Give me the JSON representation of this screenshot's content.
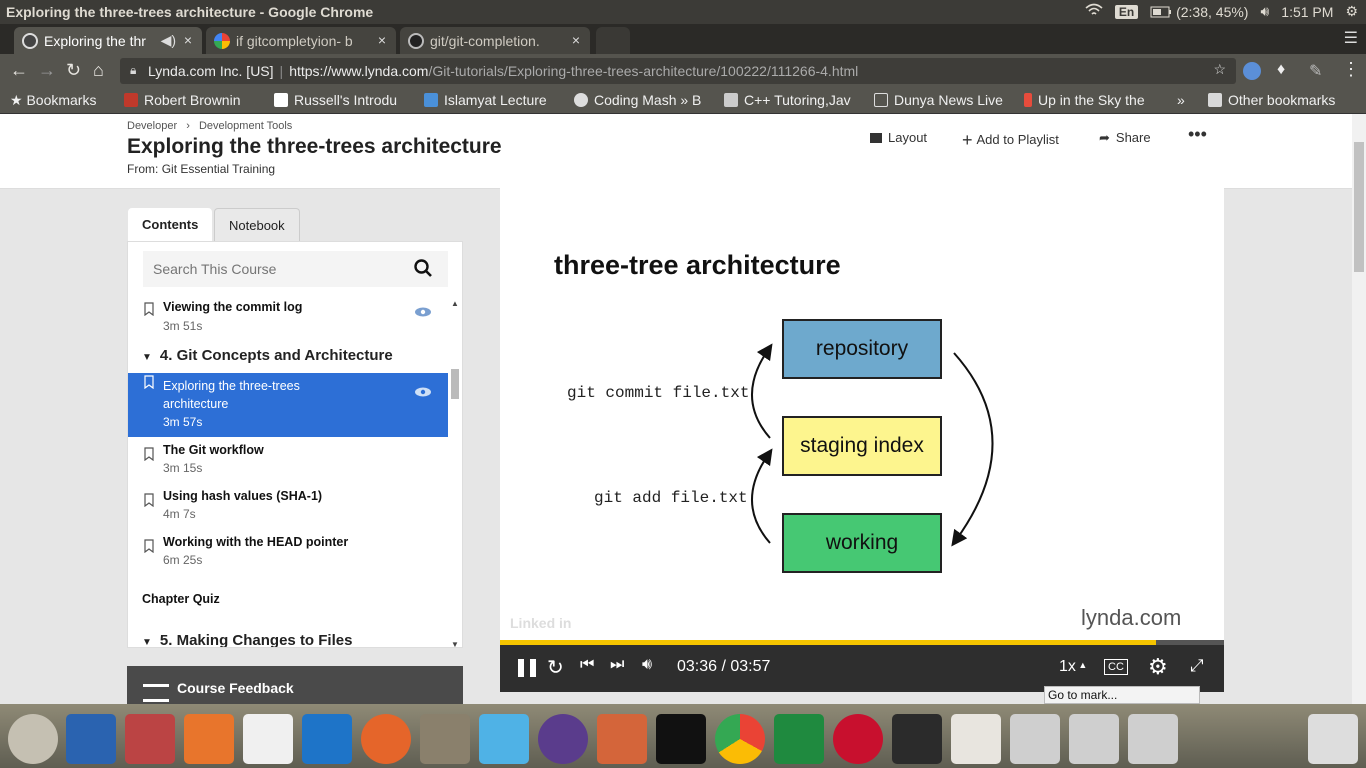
{
  "os": {
    "window_title": "Exploring the three-trees architecture - Google Chrome",
    "keyboard": "En",
    "battery": "(2:38, 45%)",
    "clock": "1:51 PM"
  },
  "tabs": [
    {
      "label": "Exploring the thr",
      "active": true
    },
    {
      "label": "if gitcompletyion- b",
      "active": false
    },
    {
      "label": "git/git-completion.",
      "active": false
    }
  ],
  "omnibox": {
    "secure_label": "Lynda.com Inc. [US]",
    "url_host": "https://www.lynda.com",
    "url_path": "/Git-tutorials/Exploring-three-trees-architecture/100222/111266-4.html"
  },
  "bookmarks": {
    "label": "Bookmarks",
    "items": [
      "Robert Brownin",
      "Russell's Introdu",
      "Islamyat Lecture",
      "Coding Mash » B",
      "C++ Tutoring,Jav",
      "Dunya News Live",
      "Up in the Sky the"
    ],
    "more": "»",
    "other": "Other bookmarks"
  },
  "page": {
    "breadcrumb_1": "Developer",
    "breadcrumb_2": "Development Tools",
    "title": "Exploring the three-trees architecture",
    "from_label": "From:",
    "from_course": "Git Essential Training",
    "layout": "Layout",
    "add_playlist": "Add to Playlist",
    "share": "Share"
  },
  "sidebar": {
    "tab_contents": "Contents",
    "tab_notebook": "Notebook",
    "search_placeholder": "Search This Course",
    "items": [
      {
        "title": "Viewing the commit log",
        "duration": "3m 51s"
      },
      {
        "chapter": "4. Git Concepts and Architecture"
      },
      {
        "title_1": "Exploring the three-trees",
        "title_2": "architecture",
        "duration": "3m 57s",
        "active": true
      },
      {
        "title": "The Git workflow",
        "duration": "3m 15s"
      },
      {
        "title": "Using hash values (SHA-1)",
        "duration": "4m 7s"
      },
      {
        "title": "Working with the HEAD pointer",
        "duration": "6m 25s"
      },
      {
        "title": "Chapter Quiz"
      },
      {
        "chapter": "5. Making Changes to Files"
      }
    ],
    "feedback": "Course Feedback"
  },
  "slide": {
    "title": "three-tree architecture",
    "box_repository": "repository",
    "box_staging": "staging index",
    "box_working": "working",
    "cmd_commit": "git commit file.txt",
    "cmd_add": "git add file.txt",
    "watermark_li": "Linked in",
    "brand": "lynda.com",
    "box_colors": {
      "repository": "#6ea9cd",
      "staging": "#fdf58e",
      "working": "#46c873"
    }
  },
  "player": {
    "time": "03:36 / 03:57",
    "progress": 0.906,
    "speed": "1x",
    "cc": "CC",
    "tooltip": "Go to mark..."
  },
  "colors": {
    "accent": "#2d6fd6",
    "progress": "#f5c400"
  }
}
